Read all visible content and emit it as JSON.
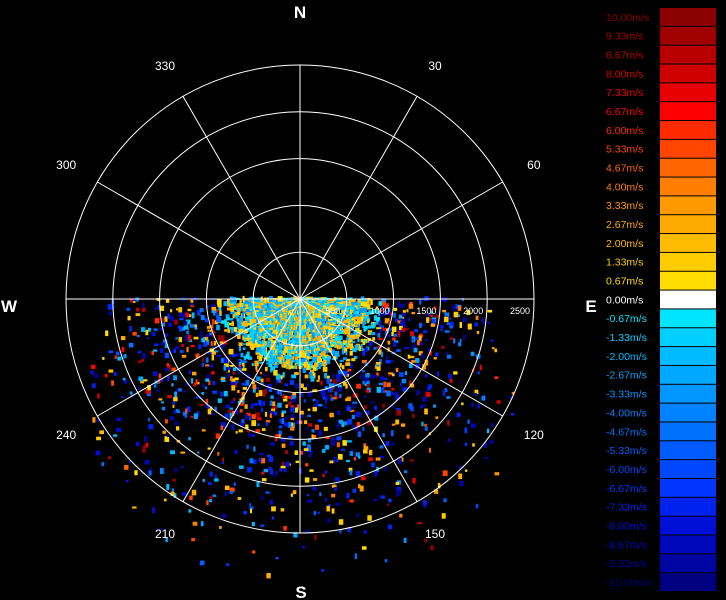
{
  "chart_data": {
    "type": "radar-ppi",
    "cardinals": {
      "north": "N",
      "east": "E",
      "south": "S",
      "west": "W"
    },
    "bearing_labels": [
      "30",
      "60",
      "120",
      "150",
      "210",
      "240",
      "300",
      "330"
    ],
    "range_labels": [
      "500",
      "1000",
      "1500",
      "2000",
      "2500"
    ],
    "range_max": 2500,
    "coverage_sector_deg": [
      90,
      270
    ],
    "colorbar": {
      "unit": "m/s",
      "labels": [
        "10.00m/s",
        "9.33m/s",
        "8.67m/s",
        "8.00m/s",
        "7.33m/s",
        "6.67m/s",
        "6.00m/s",
        "5.33m/s",
        "4.67m/s",
        "4.00m/s",
        "3.33m/s",
        "2.67m/s",
        "2.00m/s",
        "1.33m/s",
        "0.67m/s",
        "0.00m/s",
        "-0.67m/s",
        "-1.33m/s",
        "-2.00m/s",
        "-2.67m/s",
        "-3.33m/s",
        "-4.00m/s",
        "-4.67m/s",
        "-5.33m/s",
        "-6.00m/s",
        "-6.67m/s",
        "-7.33m/s",
        "-8.00m/s",
        "-8.67m/s",
        "-9.33m/s",
        "-10.00m/s"
      ],
      "colors": [
        "#8b0000",
        "#a00000",
        "#b80000",
        "#d00000",
        "#e60000",
        "#ff0000",
        "#ff2a00",
        "#ff4500",
        "#ff6600",
        "#ff7f00",
        "#ff9900",
        "#ffaa00",
        "#ffbb00",
        "#ffcc00",
        "#ffdd00",
        "#ffffff",
        "#00e5ff",
        "#00d0ff",
        "#00bbff",
        "#00a8ff",
        "#0095ff",
        "#0082ff",
        "#0070ff",
        "#005cff",
        "#0048ff",
        "#0035ff",
        "#0022ee",
        "#0010d8",
        "#0008bb",
        "#0004a0",
        "#000080"
      ],
      "label_colors": [
        "#8b0000",
        "#a00000",
        "#b80000",
        "#d00000",
        "#e60000",
        "#ff0000",
        "#ff2a00",
        "#ff4500",
        "#ff6600",
        "#ff7f00",
        "#ff9900",
        "#ffaa00",
        "#ffbb00",
        "#ffcc00",
        "#ffdd00",
        "#ffffff",
        "#00e5ff",
        "#00d0ff",
        "#00bbff",
        "#00a8ff",
        "#0095ff",
        "#0082ff",
        "#0070ff",
        "#005cff",
        "#0048ff",
        "#0035ff",
        "#0022ee",
        "#0010d8",
        "#0008bb",
        "#0004a0",
        "#000080"
      ]
    }
  }
}
